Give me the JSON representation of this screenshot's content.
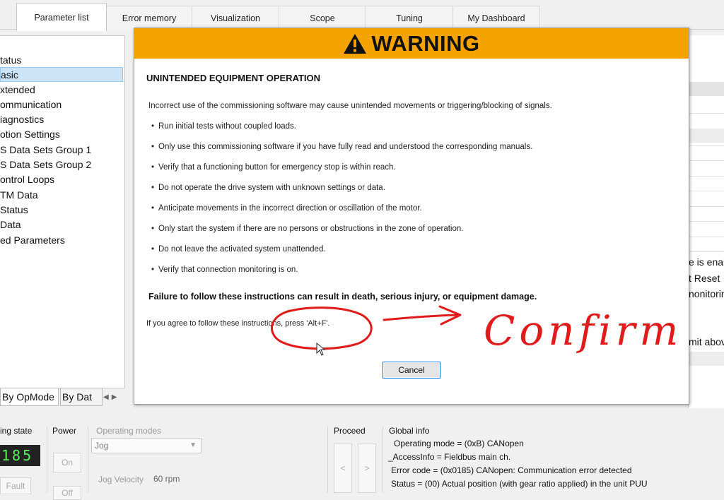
{
  "tabs": [
    {
      "label": "Parameter list",
      "active": true
    },
    {
      "label": "Error memory",
      "active": false
    },
    {
      "label": "Visualization",
      "active": false
    },
    {
      "label": "Scope",
      "active": false
    },
    {
      "label": "Tuning",
      "active": false
    },
    {
      "label": "My Dashboard",
      "active": false
    }
  ],
  "tree": {
    "items": [
      "tatus",
      "asic",
      "xtended",
      "ommunication",
      "iagnostics",
      "otion Settings",
      "S Data Sets Group 1",
      "S Data Sets Group 2",
      "ontrol Loops",
      "TM Data",
      "Status",
      "Data",
      "ed Parameters"
    ],
    "selected_index": 1,
    "bottom_tabs": [
      "By OpMode",
      "By Dat"
    ]
  },
  "right_panel": {
    "texts": [
      "e is enal",
      "t Reset",
      "nonitorin",
      "mit abov"
    ]
  },
  "bottom": {
    "operating_state_label": "ing state",
    "display_value": "185",
    "power_label": "Power",
    "power_on": "On",
    "power_off": "Off",
    "fault_label": "Fault",
    "operating_modes_label": "Operating modes",
    "operating_mode_value": "Jog",
    "jog_velocity_label": "Jog Velocity",
    "jog_velocity_value": "60 rpm",
    "proceed_label": "Proceed",
    "proceed_left": "<",
    "proceed_right": ">",
    "global_info_title": "Global info",
    "global_info": [
      "Operating mode  =  (0xB) CANopen",
      "_AccessInfo  =  Fieldbus main ch.",
      "Error code  =  (0x0185) CANopen: Communication error detected",
      "Status  =  (00) Actual position (with gear ratio applied) in the unit PUU"
    ]
  },
  "dialog": {
    "title": "WARNING",
    "heading": "UNINTENDED EQUIPMENT OPERATION",
    "intro": "Incorrect use of the commissioning software may cause unintended movements or triggering/blocking of signals.",
    "bullets": [
      "Run initial tests without coupled loads.",
      "Only use this commissioning software if you have fully read and understood the corresponding manuals.",
      "Verify that a functioning button for emergency stop is within reach.",
      "Do not operate the drive system with unknown settings or data.",
      "Anticipate movements in the incorrect direction or oscillation of the motor.",
      "Only start the system if there are no persons or obstructions in the zone of operation.",
      "Do not leave the activated system unattended.",
      "Verify that connection monitoring is on."
    ],
    "bullet_char": "•",
    "failure": "Failure to follow these instructions can result in death, serious injury, or equipment damage.",
    "agree": "If you agree to follow these instructions, press 'Alt+F'.",
    "cancel_label": "Cancel",
    "header_color": "#f5a300"
  },
  "annotation": {
    "color": "#e01b1b",
    "handwriting": "Confirm"
  }
}
